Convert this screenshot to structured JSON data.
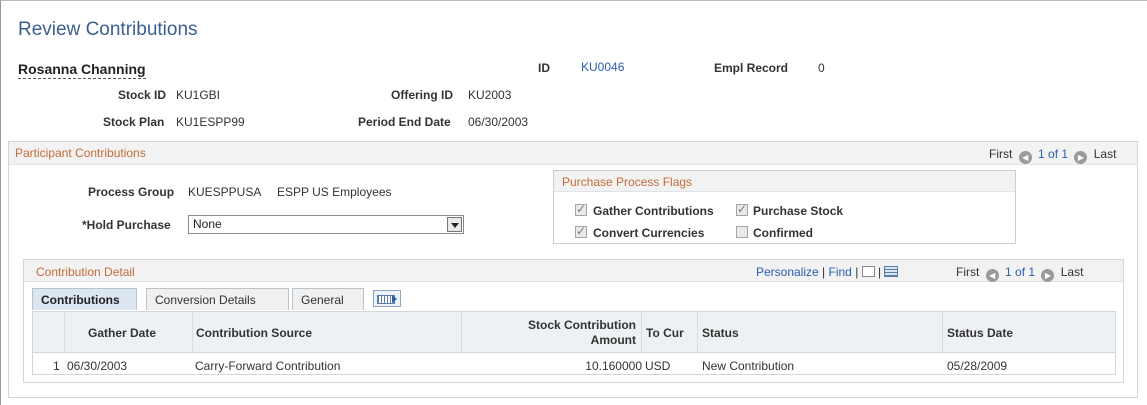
{
  "page": {
    "title": "Review Contributions",
    "employee_name": "Rosanna Channing",
    "id_label": "ID",
    "id_value": "KU0046",
    "empl_record_label": "Empl Record",
    "empl_record_value": "0",
    "stock_id_label": "Stock ID",
    "stock_id_value": "KU1GBI",
    "offering_id_label": "Offering ID",
    "offering_id_value": "KU2003",
    "stock_plan_label": "Stock Plan",
    "stock_plan_value": "KU1ESPP99",
    "period_end_label": "Period End Date",
    "period_end_value": "06/30/2003"
  },
  "participant": {
    "section_title": "Participant Contributions",
    "nav_first": "First",
    "nav_count": "1 of 1",
    "nav_last": "Last",
    "process_group_label": "Process Group",
    "process_group_code": "KUESPPUSA",
    "process_group_desc": "ESPP US Employees",
    "hold_purchase_label": "*Hold Purchase",
    "hold_purchase_value": "None"
  },
  "flags": {
    "title": "Purchase Process Flags",
    "items": [
      {
        "label": "Gather Contributions",
        "checked": true
      },
      {
        "label": "Purchase Stock",
        "checked": true
      },
      {
        "label": "Convert Currencies",
        "checked": true
      },
      {
        "label": "Confirmed",
        "checked": false
      }
    ]
  },
  "detail": {
    "title": "Contribution Detail",
    "personalize": "Personalize",
    "find": "Find",
    "sep": "|",
    "nav_first": "First",
    "nav_count": "1 of 1",
    "nav_last": "Last",
    "tabs": [
      "Contributions",
      "Conversion Details",
      "General"
    ],
    "columns": {
      "gather_date": "Gather Date",
      "source": "Contribution Source",
      "amount_1": "Stock Contribution",
      "amount_2": "Amount",
      "to_cur": "To Cur",
      "status": "Status",
      "status_date": "Status Date"
    },
    "rows": [
      {
        "num": "1",
        "gather_date": "06/30/2003",
        "source": "Carry-Forward Contribution",
        "amount": "10.160000",
        "to_cur": "USD",
        "status": "New Contribution",
        "status_date": "05/28/2009"
      }
    ]
  },
  "colors": {
    "title": "#3a5f8f",
    "section_title": "#c46a3a",
    "link": "#2b5db0"
  }
}
